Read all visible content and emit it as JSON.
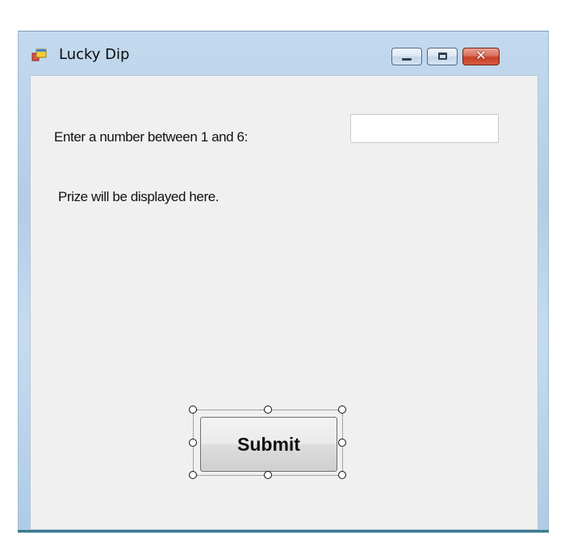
{
  "window": {
    "title": "Lucky Dip",
    "icons": {
      "app": "winform-icon",
      "minimize": "minimize-icon",
      "maximize": "maximize-icon",
      "close": "close-icon"
    },
    "close_glyph": "✕"
  },
  "form": {
    "prompt_label": "Enter a number between 1 and 6:",
    "number_input_value": "",
    "prize_label": "Prize will be displayed here.",
    "submit_label": "Submit"
  },
  "colors": {
    "close_button": "#c7402a",
    "client_background": "#f0f0f0"
  }
}
